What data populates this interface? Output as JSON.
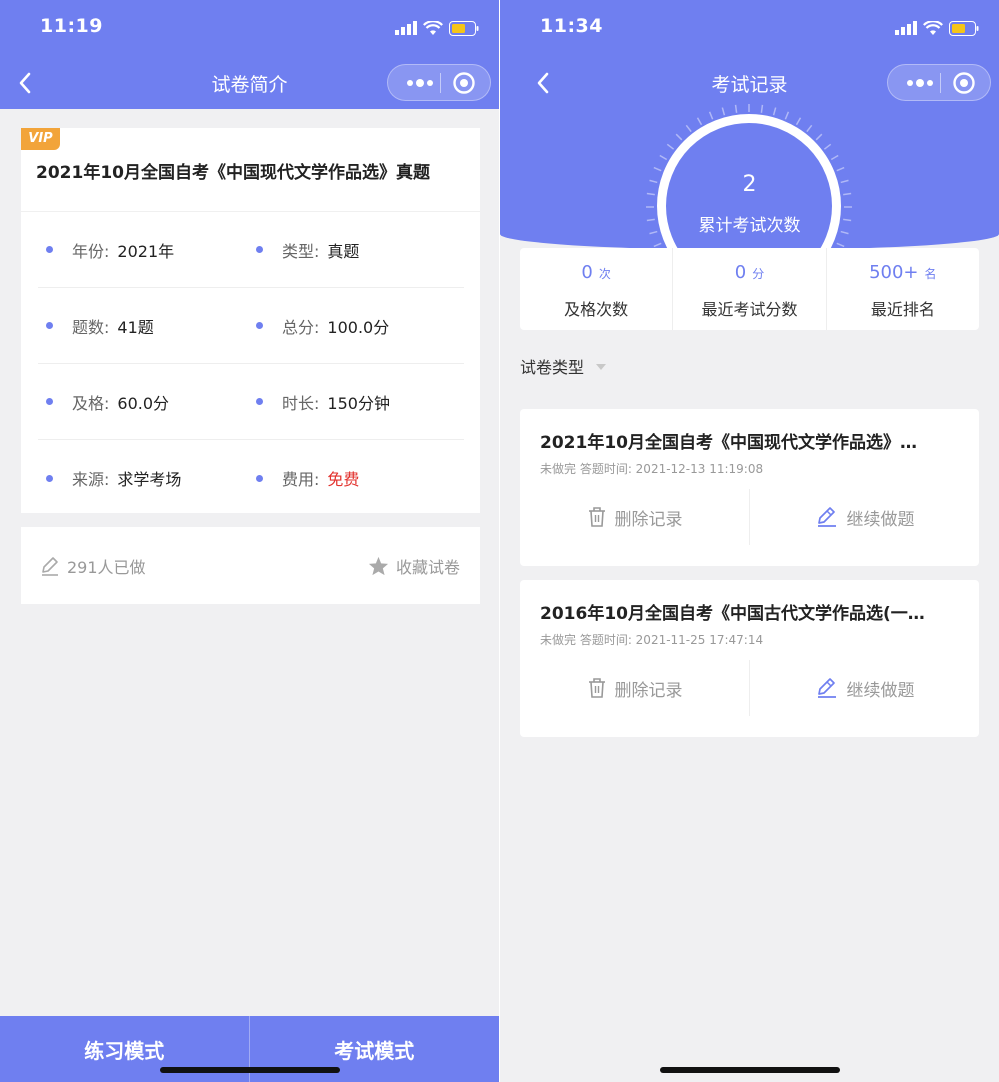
{
  "colors": {
    "brand": "#6f7ff0",
    "vip": "#f2a43a",
    "free_red": "#e2312d"
  },
  "left": {
    "status_time": "11:19",
    "nav_title": "试卷简介",
    "vip_label": "VIP",
    "paper_title": "2021年10月全国自考《中国现代文学作品选》真题",
    "info": [
      {
        "k1": "年份:",
        "v1": "2021年",
        "k2": "类型:",
        "v2": "真题"
      },
      {
        "k1": "题数:",
        "v1": "41题",
        "k2": "总分:",
        "v2": "100.0分"
      },
      {
        "k1": "及格:",
        "v1": "60.0分",
        "k2": "时长:",
        "v2": "150分钟"
      },
      {
        "k1": "来源:",
        "v1": "求学考场",
        "k2": "费用:",
        "v2": "免费"
      }
    ],
    "done_count": "291人已做",
    "favorite_label": "收藏试卷",
    "practice_mode": "练习模式",
    "exam_mode": "考试模式"
  },
  "right": {
    "status_time": "11:34",
    "nav_title": "考试记录",
    "total_count": "2",
    "total_label": "累计考试次数",
    "summary": [
      {
        "value": "0",
        "unit": "次",
        "label": "及格次数"
      },
      {
        "value": "0",
        "unit": "分",
        "label": "最近考试分数"
      },
      {
        "value": "500+",
        "unit": "名",
        "label": "最近排名"
      }
    ],
    "filter_label": "试卷类型",
    "records": [
      {
        "title": "2021年10月全国自考《中国现代文学作品选》…",
        "meta": "未做完 答题时间: 2021-12-13 11:19:08",
        "delete_label": "删除记录",
        "continue_label": "继续做题"
      },
      {
        "title": "2016年10月全国自考《中国古代文学作品选(一…",
        "meta": "未做完 答题时间: 2021-11-25 17:47:14",
        "delete_label": "删除记录",
        "continue_label": "继续做题"
      }
    ]
  }
}
